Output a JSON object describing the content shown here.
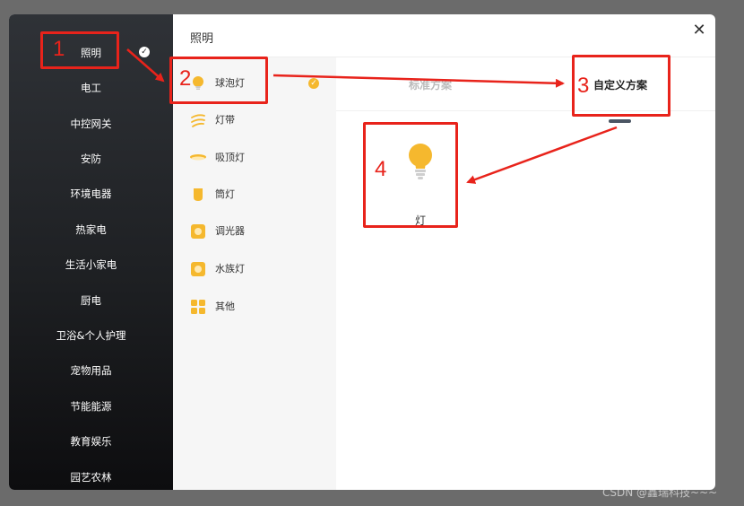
{
  "dialog": {
    "title": "照明",
    "close_icon": "close-icon"
  },
  "sidebar": {
    "items": [
      {
        "label": "照明",
        "selected": true
      },
      {
        "label": "电工"
      },
      {
        "label": "中控网关"
      },
      {
        "label": "安防"
      },
      {
        "label": "环境电器"
      },
      {
        "label": "热家电"
      },
      {
        "label": "生活小家电"
      },
      {
        "label": "厨电"
      },
      {
        "label": "卫浴&个人护理"
      },
      {
        "label": "宠物用品"
      },
      {
        "label": "节能能源"
      },
      {
        "label": "教育娱乐"
      },
      {
        "label": "园艺农林"
      }
    ]
  },
  "subcategories": {
    "items": [
      {
        "label": "球泡灯",
        "icon": "bulb-icon",
        "selected": true
      },
      {
        "label": "灯带",
        "icon": "light-strip-icon"
      },
      {
        "label": "吸顶灯",
        "icon": "ceiling-light-icon"
      },
      {
        "label": "筒灯",
        "icon": "downlight-icon"
      },
      {
        "label": "调光器",
        "icon": "dimmer-icon"
      },
      {
        "label": "水族灯",
        "icon": "aquarium-light-icon"
      },
      {
        "label": "其他",
        "icon": "grid-icon"
      }
    ]
  },
  "tabs": {
    "standard": "标准方案",
    "custom": "自定义方案",
    "active": "custom"
  },
  "products": [
    {
      "label": "灯",
      "icon": "bulb-icon"
    }
  ],
  "annotations": {
    "steps": [
      "1",
      "2",
      "3",
      "4"
    ]
  },
  "colors": {
    "accent": "#f5b82e",
    "annotation": "#e8231b",
    "sidebar_bg": "#1e2023"
  },
  "watermark": "CSDN @鑫瑞科技~~~"
}
